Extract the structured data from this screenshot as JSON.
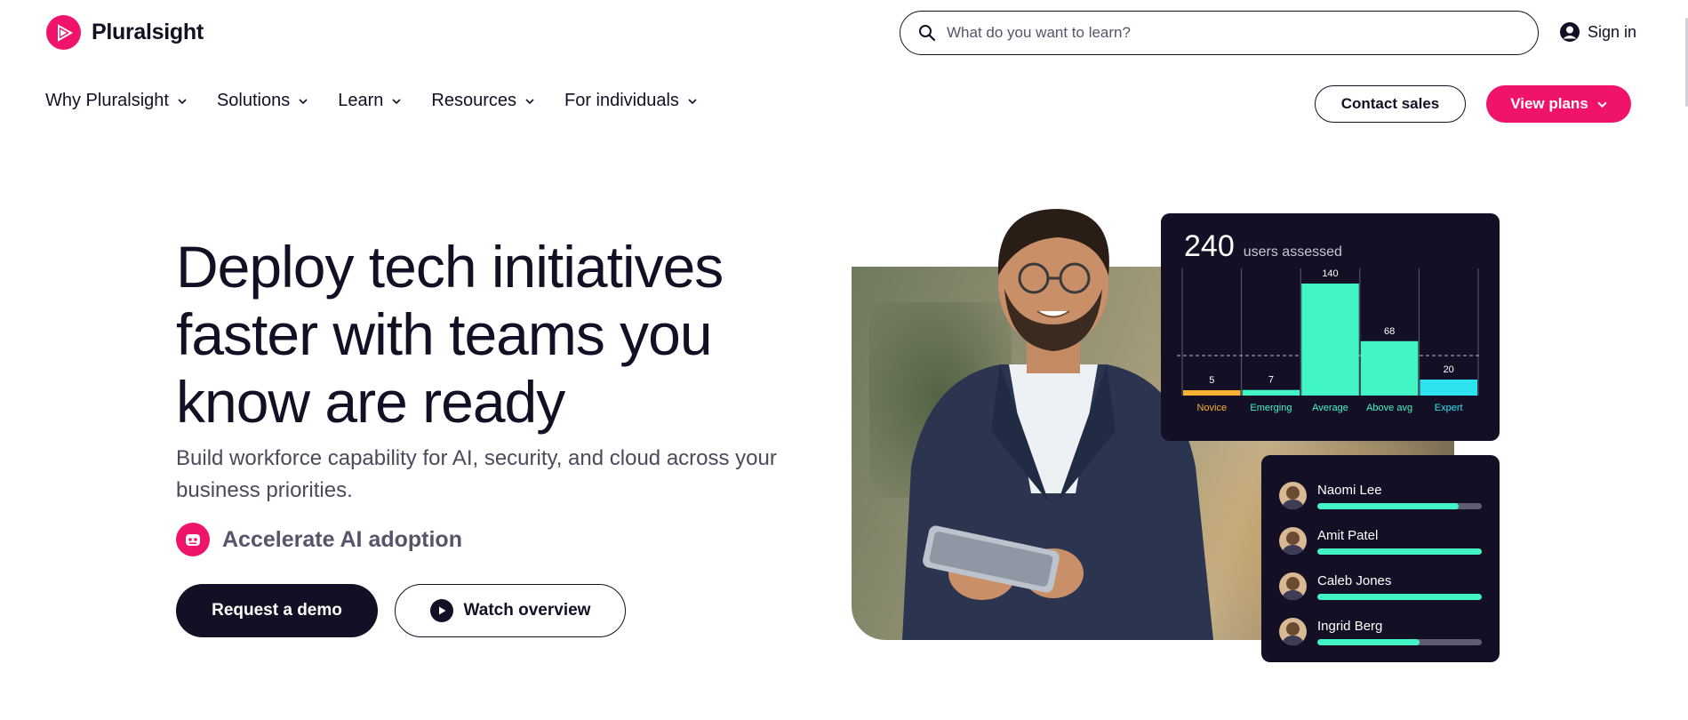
{
  "brand": {
    "name": "Pluralsight",
    "accent": "#f0136b",
    "dark": "#130f25",
    "teal": "#41f6c4"
  },
  "search": {
    "placeholder": "What do you want to learn?"
  },
  "account": {
    "signin_label": "Sign in"
  },
  "nav": {
    "items": [
      {
        "label": "Why Pluralsight"
      },
      {
        "label": "Solutions"
      },
      {
        "label": "Learn"
      },
      {
        "label": "Resources"
      },
      {
        "label": "For individuals"
      }
    ],
    "contact_label": "Contact sales",
    "plans_label": "View plans"
  },
  "hero": {
    "headline": "Deploy tech initiatives faster with teams you know are ready",
    "subhead": "Build workforce capability for AI, security, and cloud across your business priorities.",
    "feature": "Accelerate AI adoption",
    "demo_label": "Request a demo",
    "watch_label": "Watch overview"
  },
  "chart_card": {
    "count": "240",
    "caption": "users assessed"
  },
  "chart_data": {
    "type": "bar",
    "categories": [
      "Novice",
      "Emerging",
      "Average",
      "Above avg",
      "Expert"
    ],
    "values": [
      5,
      7,
      140,
      68,
      20
    ],
    "bar_colors": [
      "#f9b233",
      "#41f6c4",
      "#41f6c4",
      "#41f6c4",
      "#2ee3f0"
    ],
    "label_colors": [
      "#f9b233",
      "#41f6c4",
      "#41f6c4",
      "#41f6c4",
      "#2ee3f0"
    ],
    "title": "",
    "xlabel": "",
    "ylabel": "",
    "ylim": [
      0,
      150
    ],
    "reference_line": 50,
    "grid": true
  },
  "users": [
    {
      "name": "Naomi Lee",
      "progress": 0.86
    },
    {
      "name": "Amit Patel",
      "progress": 1.0
    },
    {
      "name": "Caleb Jones",
      "progress": 1.0
    },
    {
      "name": "Ingrid Berg",
      "progress": 0.62
    }
  ]
}
